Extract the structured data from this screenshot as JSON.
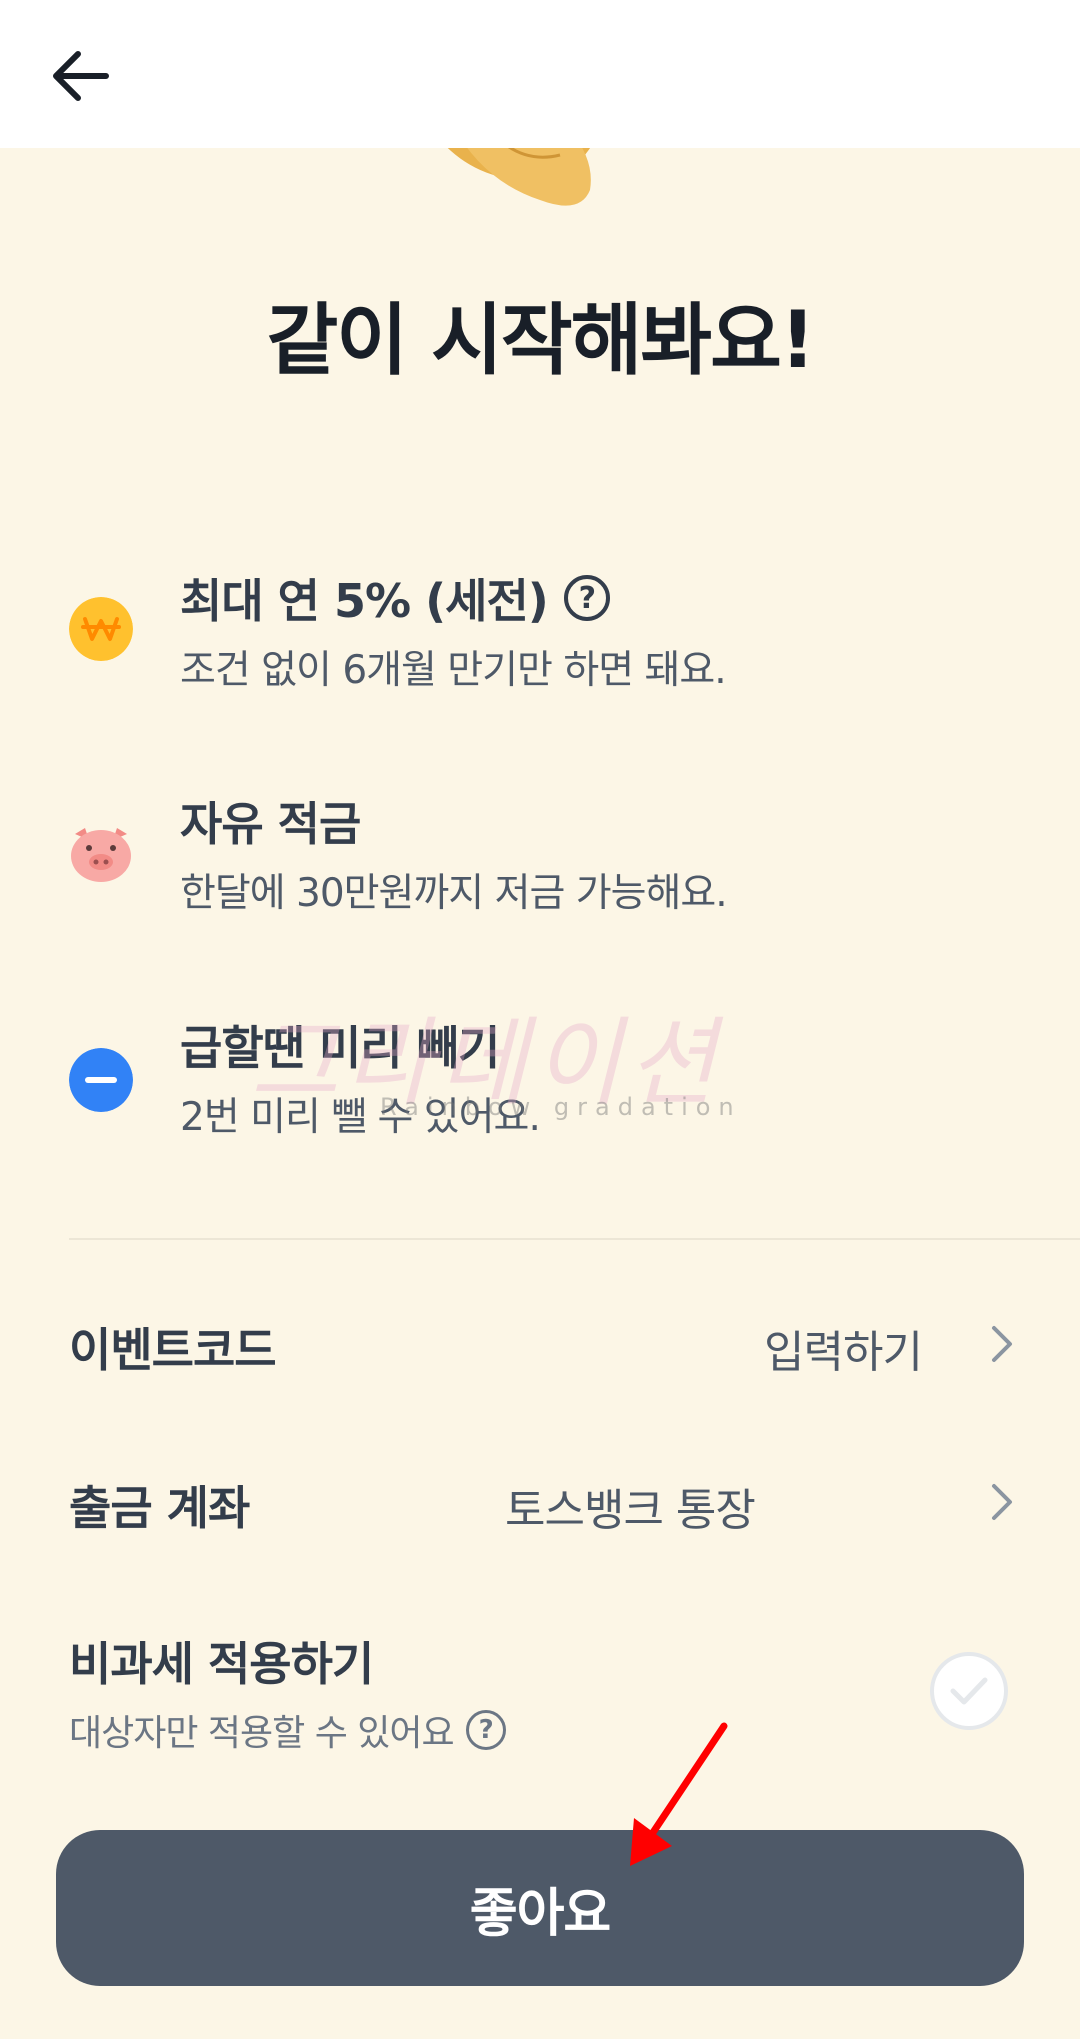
{
  "header": {
    "back_icon": "arrow-left-icon"
  },
  "hero": {
    "image": "bungeoppang-fish-pastry-illustration"
  },
  "title": "같이 시작해봐요!",
  "features": [
    {
      "icon": "won-coin-icon",
      "title": "최대 연 5% (세전)",
      "has_help": true,
      "help_glyph": "?",
      "desc": "조건 없이 6개월 만기만 하면 돼요."
    },
    {
      "icon": "piggy-bank-icon",
      "title": "자유 적금",
      "has_help": false,
      "desc": "한달에 30만원까지 저금 가능해요."
    },
    {
      "icon": "minus-circle-icon",
      "title": "급할땐 미리 빼기",
      "has_help": false,
      "desc": "2번 미리 뺄 수 있어요."
    }
  ],
  "rows": {
    "event_code": {
      "label": "이벤트코드",
      "value": "입력하기"
    },
    "withdraw_account": {
      "label": "출금 계좌",
      "value": "토스뱅크 통장"
    }
  },
  "tax_free": {
    "title": "비과세 적용하기",
    "subtitle": "대상자만 적용할 수 있어요",
    "help_glyph": "?"
  },
  "cta": {
    "label": "좋아요"
  },
  "watermark": {
    "script": "그라데이션",
    "text": "Rainbow gradation"
  },
  "colors": {
    "background": "#fcf6e6",
    "cta": "#4e5968",
    "won_coin": "#ffc12e",
    "pig": "#f8a9a5",
    "minus_icon": "#3182f6",
    "annotation_arrow": "#ff0000"
  }
}
